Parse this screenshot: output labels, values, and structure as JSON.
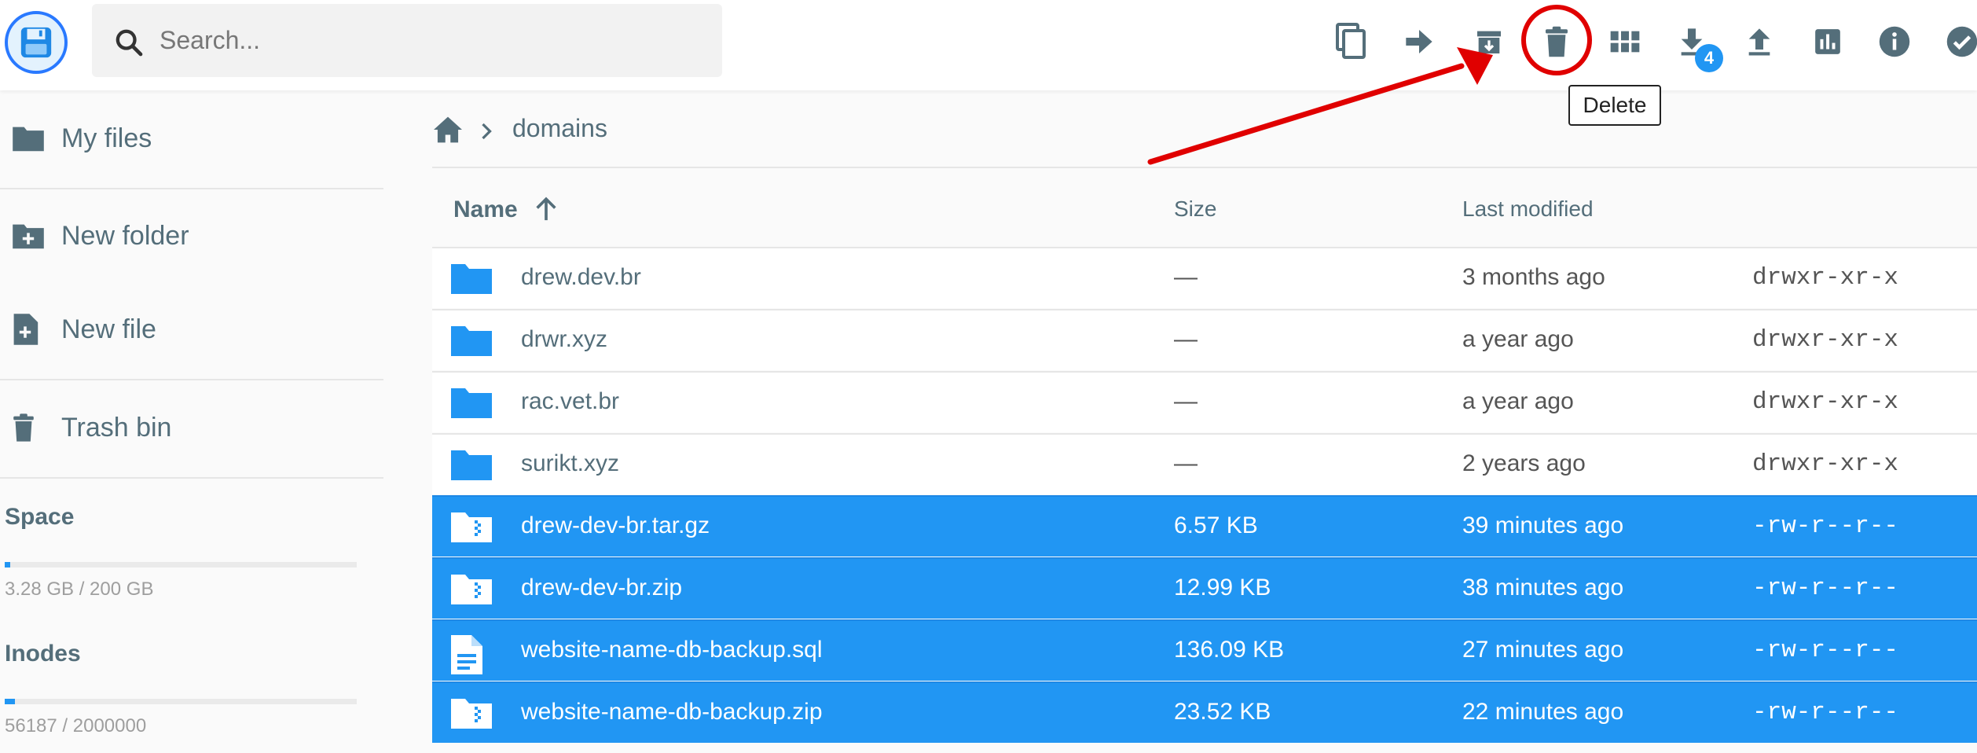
{
  "header": {
    "search_placeholder": "Search...",
    "badge_count": "4",
    "tooltip": "Delete",
    "toolbar": [
      "copy-icon",
      "move-icon",
      "archive-icon",
      "delete-icon",
      "grid-view-icon",
      "download-icon",
      "upload-icon",
      "chart-icon",
      "info-icon",
      "select-icon"
    ]
  },
  "sidebar": {
    "items": [
      {
        "label": "My files",
        "icon": "folder-icon"
      },
      {
        "label": "New folder",
        "icon": "create-new-folder-icon"
      },
      {
        "label": "New file",
        "icon": "note-add-icon"
      },
      {
        "label": "Trash bin",
        "icon": "trash-icon"
      }
    ],
    "space": {
      "title": "Space",
      "text": "3.28 GB / 200 GB",
      "fraction": 0.0164
    },
    "inodes": {
      "title": "Inodes",
      "text": "56187 / 2000000",
      "fraction": 0.028
    }
  },
  "breadcrumb": {
    "current": "domains"
  },
  "list": {
    "columns": {
      "name": "Name",
      "size": "Size",
      "modified": "Last modified"
    },
    "rows": [
      {
        "name": "drew.dev.br",
        "size": "—",
        "modified": "3 months ago",
        "perm": "drwxr-xr-x",
        "type": "folder",
        "selected": false
      },
      {
        "name": "drwr.xyz",
        "size": "—",
        "modified": "a year ago",
        "perm": "drwxr-xr-x",
        "type": "folder",
        "selected": false
      },
      {
        "name": "rac.vet.br",
        "size": "—",
        "modified": "a year ago",
        "perm": "drwxr-xr-x",
        "type": "folder",
        "selected": false
      },
      {
        "name": "surikt.xyz",
        "size": "—",
        "modified": "2 years ago",
        "perm": "drwxr-xr-x",
        "type": "folder",
        "selected": false
      },
      {
        "name": "drew-dev-br.tar.gz",
        "size": "6.57 KB",
        "modified": "39 minutes ago",
        "perm": "-rw-r--r--",
        "type": "archive",
        "selected": true
      },
      {
        "name": "drew-dev-br.zip",
        "size": "12.99 KB",
        "modified": "38 minutes ago",
        "perm": "-rw-r--r--",
        "type": "archive",
        "selected": true
      },
      {
        "name": "website-name-db-backup.sql",
        "size": "136.09 KB",
        "modified": "27 minutes ago",
        "perm": "-rw-r--r--",
        "type": "document",
        "selected": true
      },
      {
        "name": "website-name-db-backup.zip",
        "size": "23.52 KB",
        "modified": "22 minutes ago",
        "perm": "-rw-r--r--",
        "type": "archive",
        "selected": true
      }
    ]
  },
  "colors": {
    "accent": "#2196f3",
    "annotation": "#e00000",
    "icon": "#546e7a"
  }
}
